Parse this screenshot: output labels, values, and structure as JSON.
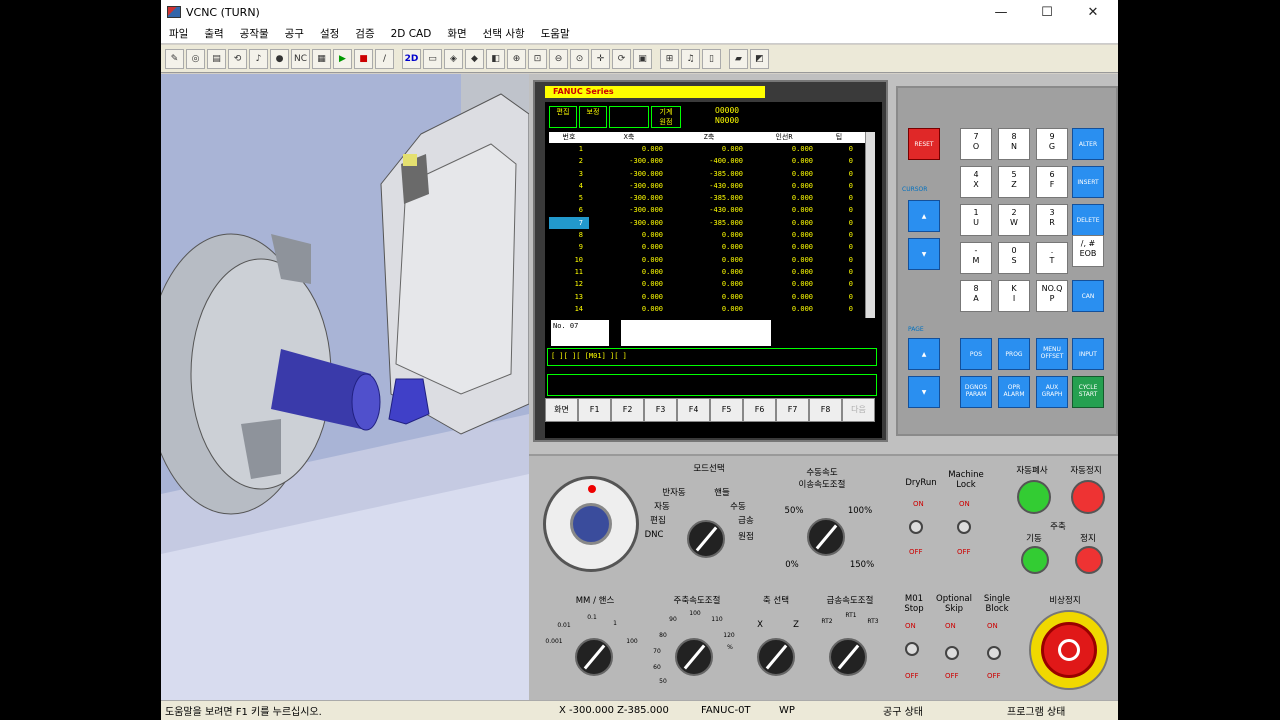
{
  "window": {
    "title": "VCNC (TURN)"
  },
  "menu": [
    "파일",
    "출력",
    "공작물",
    "공구",
    "설정",
    "검증",
    "2D CAD",
    "화면",
    "선택 사항",
    "도움말"
  ],
  "toolbar": {
    "view2d_label": "2D",
    "nc_label": "NC"
  },
  "screen": {
    "brand": "FANUC Series",
    "mode_cells": [
      "편집",
      "보정",
      "",
      "기계\n원점"
    ],
    "program": "O0000",
    "seq": "N0000",
    "columns": [
      "번호",
      "X축",
      "Z축",
      "인선R",
      "팁"
    ],
    "rows": [
      [
        "1",
        "0.000",
        "0.000",
        "0.000",
        "0"
      ],
      [
        "2",
        "-300.000",
        "-400.000",
        "0.000",
        "0"
      ],
      [
        "3",
        "-300.000",
        "-385.000",
        "0.000",
        "0"
      ],
      [
        "4",
        "-300.000",
        "-430.000",
        "0.000",
        "0"
      ],
      [
        "5",
        "-300.000",
        "-385.000",
        "0.000",
        "0"
      ],
      [
        "6",
        "-300.000",
        "-430.000",
        "0.000",
        "0"
      ],
      [
        "7",
        "-300.000",
        "-385.000",
        "0.000",
        "0"
      ],
      [
        "8",
        "0.000",
        "0.000",
        "0.000",
        "0"
      ],
      [
        "9",
        "0.000",
        "0.000",
        "0.000",
        "0"
      ],
      [
        "10",
        "0.000",
        "0.000",
        "0.000",
        "0"
      ],
      [
        "11",
        "0.000",
        "0.000",
        "0.000",
        "0"
      ],
      [
        "12",
        "0.000",
        "0.000",
        "0.000",
        "0"
      ],
      [
        "13",
        "0.000",
        "0.000",
        "0.000",
        "0"
      ],
      [
        "14",
        "0.000",
        "0.000",
        "0.000",
        "0"
      ]
    ],
    "input_label": "No. 07",
    "cmd_line": "[   ][   ][ [M01] ][     ]",
    "softkeys": [
      "화면",
      "F1",
      "F2",
      "F3",
      "F4",
      "F5",
      "F6",
      "F7",
      "F8",
      "다음"
    ]
  },
  "keypad": {
    "reset": "RESET",
    "cursor_label": "CURSOR",
    "page_label": "PAGE",
    "keys": [
      "7\nO",
      "8\nN",
      "9\nG",
      "4\nX",
      "5\nZ",
      "6\nF",
      "1\nU",
      "2\nW",
      "3\nR",
      "-\nM",
      "0\nS",
      ".\nT",
      "8\nA",
      "K\nI",
      "NO.Q\nP"
    ],
    "blue": [
      "ALTER",
      "INSERT",
      "DELETE",
      "CAN",
      "POS",
      "PROG",
      "MENU\nOFFSET",
      "INPUT",
      "DGNOS\nPARAM",
      "OPR\nALARM",
      "AUX\nGRAPH"
    ],
    "eob": "/, #\nEOB",
    "cycle_start": "CYCLE\nSTART"
  },
  "lower": {
    "mode_select": "모드선택",
    "mode_options": [
      "반자동",
      "핸들",
      "자동",
      "수동",
      "편집",
      "급송",
      "DNC",
      "원점"
    ],
    "feed_label": "수동속도\n이송속도조절",
    "feed_marks": [
      "50%",
      "100%",
      "0%",
      "150%"
    ],
    "dryrun": "DryRun",
    "machine_lock": "Machine\nLock",
    "auto_run": "자동폐사",
    "auto_stop": "자동정지",
    "spindle": "주축",
    "forward": "기동",
    "stop": "정지",
    "mm_handle": "MM / 핸스",
    "mm_marks": [
      "0.01",
      "0.1",
      "1",
      "0.001",
      "100"
    ],
    "spindle_speed": "주축속도조절",
    "spindle_marks": [
      "90",
      "100",
      "110",
      "80",
      "120",
      "70",
      "%",
      "60",
      "50"
    ],
    "axis_select": "축 선택",
    "axis_marks": [
      "X",
      "Z"
    ],
    "rapid": "급송속도조절",
    "rapid_marks": [
      "RT2",
      "RT1",
      "RT3"
    ],
    "m01": "M01\nStop",
    "optional_skip": "Optional\nSkip",
    "single_block": "Single\nBlock",
    "emergency": "비상정지",
    "on": "ON",
    "off": "OFF"
  },
  "status": {
    "help": "도움말을 보려면 F1 키를 누르십시오.",
    "coords": "X -300.000  Z-385.000",
    "control": "FANUC-0T",
    "wp": "WP",
    "tool_state": "공구 상태",
    "program_state": "프로그램 상태"
  }
}
